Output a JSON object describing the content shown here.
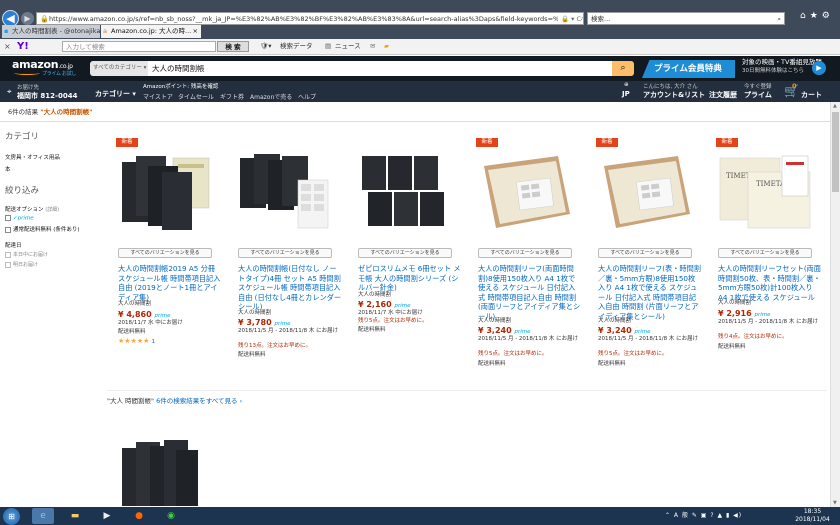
{
  "browser": {
    "url": "https://www.amazon.co.jp/s/ref=nb_sb_noss?__mk_ja_JP=%E3%82%AB%E3%82%BF%E3%82%AB%E3%83%8A&url=search-alias%3Daps&field-keywords=%E5%A4%A7%",
    "search_placeholder": "検索...",
    "tabs": [
      {
        "label": "大人の時間割表 - @otonajika..."
      },
      {
        "label": "Amazon.co.jp: 大人の時..."
      }
    ]
  },
  "yahoo_toolbar": {
    "logo": "Y!",
    "search_placeholder": "入力して検索",
    "search_button": "検 索",
    "items": [
      "検索データ",
      "ニュース"
    ]
  },
  "header": {
    "logo": "amazon",
    "logo_suffix": ".co.jp",
    "logo_sub": "プライム お試し",
    "category": "すべてのカテゴリー",
    "query": "大人の時間割帳",
    "prime_banner": "プライム会員特典",
    "promo_line1": "対象の映画・TV番組見放題",
    "promo_line2": "30日間無料体験はこちら"
  },
  "nav": {
    "deliver_label": "お届け先",
    "deliver_value": "福岡市 812-0044",
    "department": "カテゴリー ▾",
    "points": "Amazonポイント: 残高を確認",
    "links": [
      "マイストア",
      "タイムセール",
      "ギフト券",
      "Amazonで売る",
      "ヘルプ"
    ],
    "lang": "JP",
    "greeting": "こんにちは, 大介 さん",
    "account": "アカウント&リスト",
    "orders": "注文履歴",
    "prime_pre": "今すぐ登録",
    "prime": "プライム",
    "cart": "カート",
    "cart_count": "0"
  },
  "results": {
    "count": "6件の結果",
    "query": "\"大人の時間割帳\""
  },
  "sidebar": {
    "category_heading": "カテゴリ",
    "categories": [
      "文房具・オフィス用品",
      "本"
    ],
    "refine_heading": "絞り込み",
    "delivery_option": "配送オプション",
    "delivery_option_note": "(詳細)",
    "prime_label": "✓prime",
    "free_shipping": "通常配送料無料 (条件あり)",
    "delivery_date": "配達日",
    "today": "本日中にお届け",
    "tomorrow": "明日お届け"
  },
  "products": [
    {
      "badge": "新着",
      "variation": "すべてのバリエーションを見る",
      "title": "大人の時間割帳2019 A5 分冊スケジュール帳 時間帯項目記入自由 (2019とノート1冊とアイディア集)",
      "brand": "大人の時間割",
      "price": "¥ 4,860",
      "prime": "prime",
      "delivery": "2018/11/7 水 中にお届け",
      "shipping": "配送料無料",
      "stars": "★★★★★",
      "reviews": "1"
    },
    {
      "badge": "",
      "variation": "すべてのバリエーションを見る",
      "title": "大人の時間割帳(日付なし ノートタイプ)4冊 セット A5 時間割 スケジュール帳 時間帯項目記入自由 (日付なし4冊とカレンダーシール)",
      "brand": "大人の時間割",
      "price": "¥ 3,780",
      "prime": "prime",
      "delivery": "2018/11/5 月 - 2018/11/8 木 にお届け",
      "warning": "残り13点。注文はお早めに。",
      "shipping": "配送料無料"
    },
    {
      "badge": "",
      "variation": "すべてのバリエーションを見る",
      "title": "ゼピロスリムメモ 6冊セット メモ帳 大人の時間割シリーズ (シルバー針金)",
      "brand": "大人の時間割",
      "price": "¥ 2,160",
      "prime": "prime",
      "delivery": "2018/11/7 水 中にお届け",
      "warning": "残り5点。注文はお早めに。",
      "shipping": "配送料無料"
    },
    {
      "badge": "新着",
      "variation": "すべてのバリエーションを見る",
      "title": "大人の時間割リーフ(両面時間割)8使用150枚入り A4 1枚で使える スケジュール 日付記入式 時間帯項目記入自由 時間割 (両面リーフとアイディア集とシール)",
      "brand": "大人の時間割",
      "price": "¥ 3,240",
      "prime": "prime",
      "delivery": "2018/11/5 月 - 2018/11/8 木 にお届け",
      "warning": "残り5点。注文はお早めに。",
      "shipping": "配送料無料"
    },
    {
      "badge": "新着",
      "variation": "すべてのバリエーションを見る",
      "title": "大人の時間割リーフ(表・時間割／裏・5mm方眼)8使用150枚入り A4 1枚で使える スケジュール 日付記入式 時間帯項目記入自由 時間割 (片面リーフとアイディア集とシール)",
      "brand": "大人の時間割",
      "price": "¥ 3,240",
      "prime": "prime",
      "delivery": "2018/11/5 月 - 2018/11/8 木 にお届け",
      "warning": "残り5点。注文はお早めに。",
      "shipping": "配送料無料"
    },
    {
      "badge": "新着",
      "variation": "すべてのバリエーションを見る",
      "title": "大人の時間割リーフセット(両面時間割50枚、表・時間割／裏・5mm方眼50枚)計100枚入り A4 1枚で使える スケジュール",
      "brand": "大人の時間割",
      "price": "¥ 2,916",
      "prime": "prime",
      "delivery": "2018/11/5 月 - 2018/11/8 木 にお届け",
      "warning": "残り4点。注文はお早めに。",
      "shipping": "配送料無料"
    }
  ],
  "more_results": {
    "query": "\"大人 時間割帳\"",
    "link": "6件の検索結果をすべて見る ›"
  },
  "taskbar": {
    "time": "18:35",
    "date": "2018/11/04"
  },
  "colors": {
    "amazon_dark": "#131921",
    "amazon_nav": "#232f3e",
    "search_button": "#febd69",
    "prime_blue": "#1f8dd6",
    "price_red": "#b12704",
    "link_blue": "#0066c0",
    "badge_red": "#e2431a"
  }
}
